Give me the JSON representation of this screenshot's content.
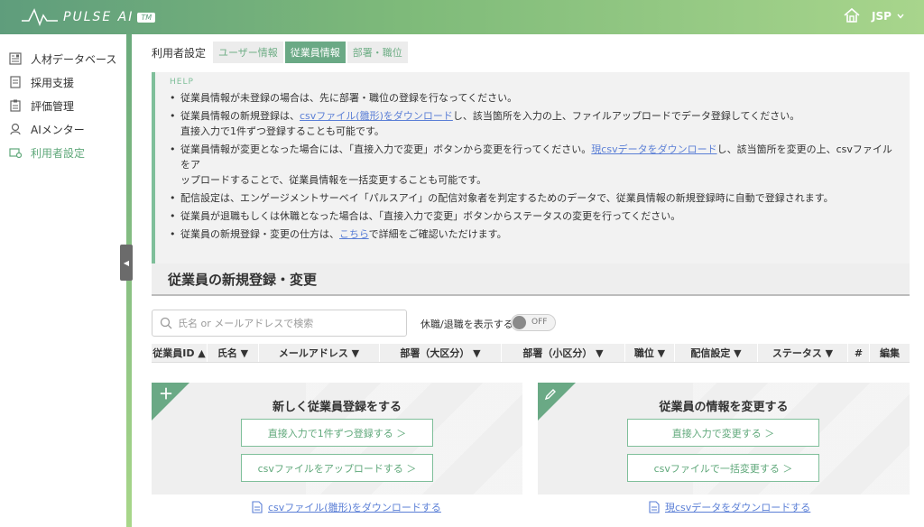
{
  "header": {
    "logo_text": "PULSE AI",
    "logo_tm": "TM",
    "user_label": "JSP",
    "colors": {
      "bar_start": "#5f9d7c",
      "bar_end": "#a8d58c"
    }
  },
  "sidebar": {
    "items": [
      {
        "label": "人材データベース",
        "icon": "database-icon"
      },
      {
        "label": "採用支援",
        "icon": "document-icon"
      },
      {
        "label": "評価管理",
        "icon": "clipboard-icon"
      },
      {
        "label": "AIメンター",
        "icon": "mentor-icon"
      },
      {
        "label": "利用者設定",
        "icon": "settings-icon",
        "active": true
      }
    ]
  },
  "tabs": {
    "title": "利用者設定",
    "items": [
      {
        "label": "ユーザー情報"
      },
      {
        "label": "従業員情報",
        "active": true
      },
      {
        "label": "部署・職位"
      }
    ]
  },
  "help": {
    "label": "HELP",
    "items": [
      {
        "text": "従業員情報が未登録の場合は、先に部署・職位の登録を行なってください。"
      },
      {
        "pre": "従業員情報の新規登録は、",
        "link": "csvファイル(雛形)をダウンロード",
        "post": "し、該当箇所を入力の上、ファイルアップロードでデータ登録してください。",
        "line2": "直接入力で1件ずつ登録することも可能です。"
      },
      {
        "pre": "従業員情報が変更となった場合には、「直接入力で変更」ボタンから変更を行ってください。",
        "link": "現csvデータをダウンロード",
        "post": "し、該当箇所を変更の上、csvファイルをア",
        "line2": "ップロードすることで、従業員情報を一括変更することも可能です。"
      },
      {
        "text": "配信設定は、エンゲージメントサーベイ「パルスアイ」の配信対象者を判定するためのデータで、従業員情報の新規登録時に自動で登録されます。"
      },
      {
        "text": "従業員が退職もしくは休職となった場合は、「直接入力で変更」ボタンからステータスの変更を行ってください。"
      },
      {
        "pre": "従業員の新規登録・変更の仕方は、",
        "link": "こちら",
        "post": "で詳細をご確認いただけます。"
      }
    ]
  },
  "section": {
    "title": "従業員の新規登録・変更"
  },
  "search": {
    "placeholder": "氏名 or メールアドレスで検索",
    "value": ""
  },
  "toggle": {
    "label": "休職/退職を表示する",
    "state": "OFF"
  },
  "table": {
    "columns": [
      {
        "label": "従業員ID ▲"
      },
      {
        "label": "氏名 ▼"
      },
      {
        "label": "メールアドレス ▼"
      },
      {
        "label": "部署（大区分） ▼"
      },
      {
        "label": "部署（小区分） ▼"
      },
      {
        "label": "職位 ▼"
      },
      {
        "label": "配信設定 ▼"
      },
      {
        "label": "ステータス ▼"
      },
      {
        "label": "#"
      },
      {
        "label": "編集"
      }
    ]
  },
  "cards": {
    "new": {
      "title": "新しく従業員登録をする",
      "btn1": "直接入力で1件ずつ登録する ＞",
      "btn2": "csvファイルをアップロードする ＞",
      "link": "csvファイル(雛形)をダウンロードする"
    },
    "edit": {
      "title": "従業員の情報を変更する",
      "btn1": "直接入力で変更する ＞",
      "btn2": "csvファイルで一括変更する ＞",
      "link": "現csvデータをダウンロードする"
    }
  }
}
